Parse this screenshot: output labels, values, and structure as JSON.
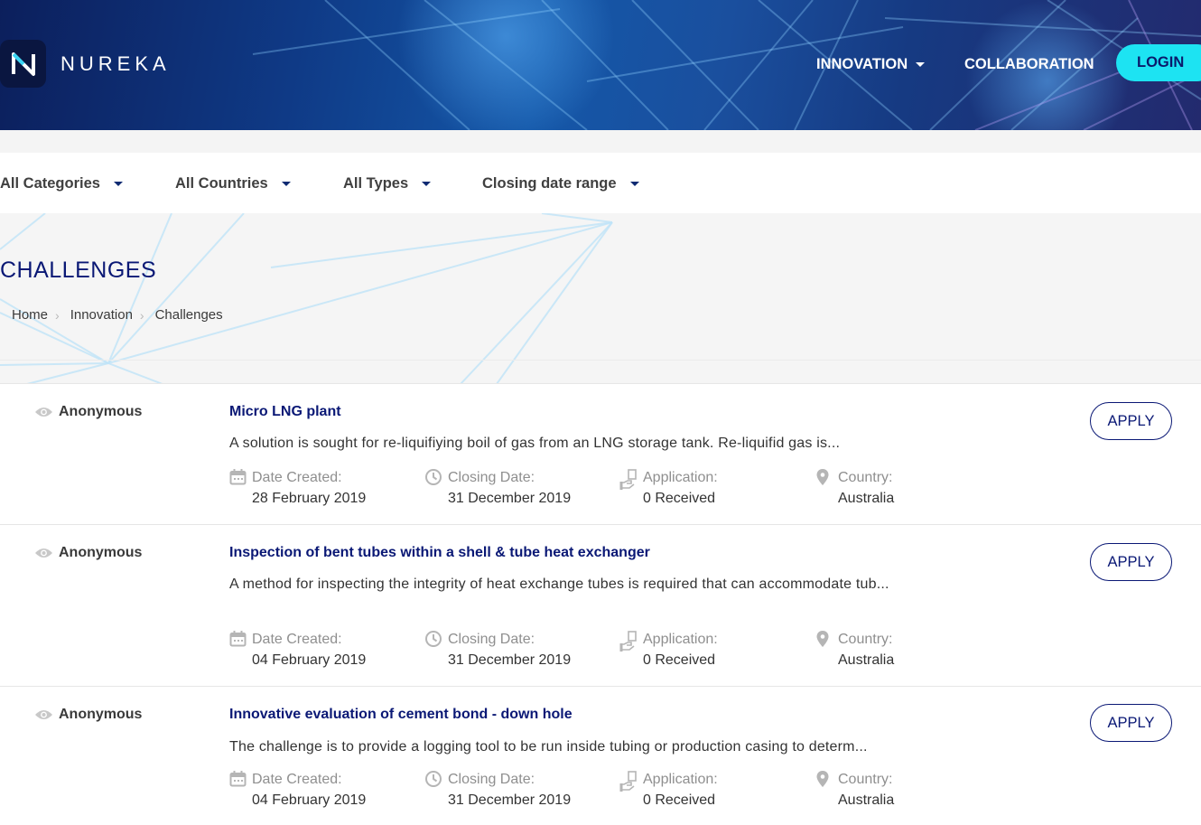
{
  "header": {
    "brand": "NUREKA",
    "nav": [
      {
        "label": "INNOVATION"
      },
      {
        "label": "COLLABORATION"
      }
    ],
    "login_label": "LOGIN",
    "colors": {
      "accent": "#1de3f2",
      "navy": "#0a1875"
    }
  },
  "filters": [
    {
      "label": "All Categories"
    },
    {
      "label": "All Countries"
    },
    {
      "label": "All Types"
    },
    {
      "label": "Closing date range"
    }
  ],
  "page": {
    "title": "CHALLENGES",
    "breadcrumb": [
      "Home",
      "Innovation",
      "Challenges"
    ]
  },
  "labels": {
    "date_created": "Date Created:",
    "closing_date": "Closing Date:",
    "application": "Application:",
    "country": "Country:",
    "apply": "APPLY"
  },
  "challenges": [
    {
      "poster": "Anonymous",
      "title": "Micro LNG plant",
      "description": "A solution is sought for re-liquifiying boil of gas from an LNG storage tank. Re-liquifid gas is...",
      "date_created": "28 February 2019",
      "closing_date": "31 December 2019",
      "applications": "0 Received",
      "country": "Australia"
    },
    {
      "poster": "Anonymous",
      "title": "Inspection of bent tubes within a shell & tube heat exchanger",
      "description": "A method for inspecting the integrity of heat exchange tubes is required that can accommodate tub...",
      "date_created": "04 February 2019",
      "closing_date": "31 December 2019",
      "applications": "0 Received",
      "country": "Australia"
    },
    {
      "poster": "Anonymous",
      "title": "Innovative evaluation of cement bond - down hole",
      "description": "The challenge is to provide a logging tool to be run inside tubing or production casing to determ...",
      "date_created": "04 February 2019",
      "closing_date": "31 December 2019",
      "applications": "0 Received",
      "country": "Australia"
    }
  ]
}
